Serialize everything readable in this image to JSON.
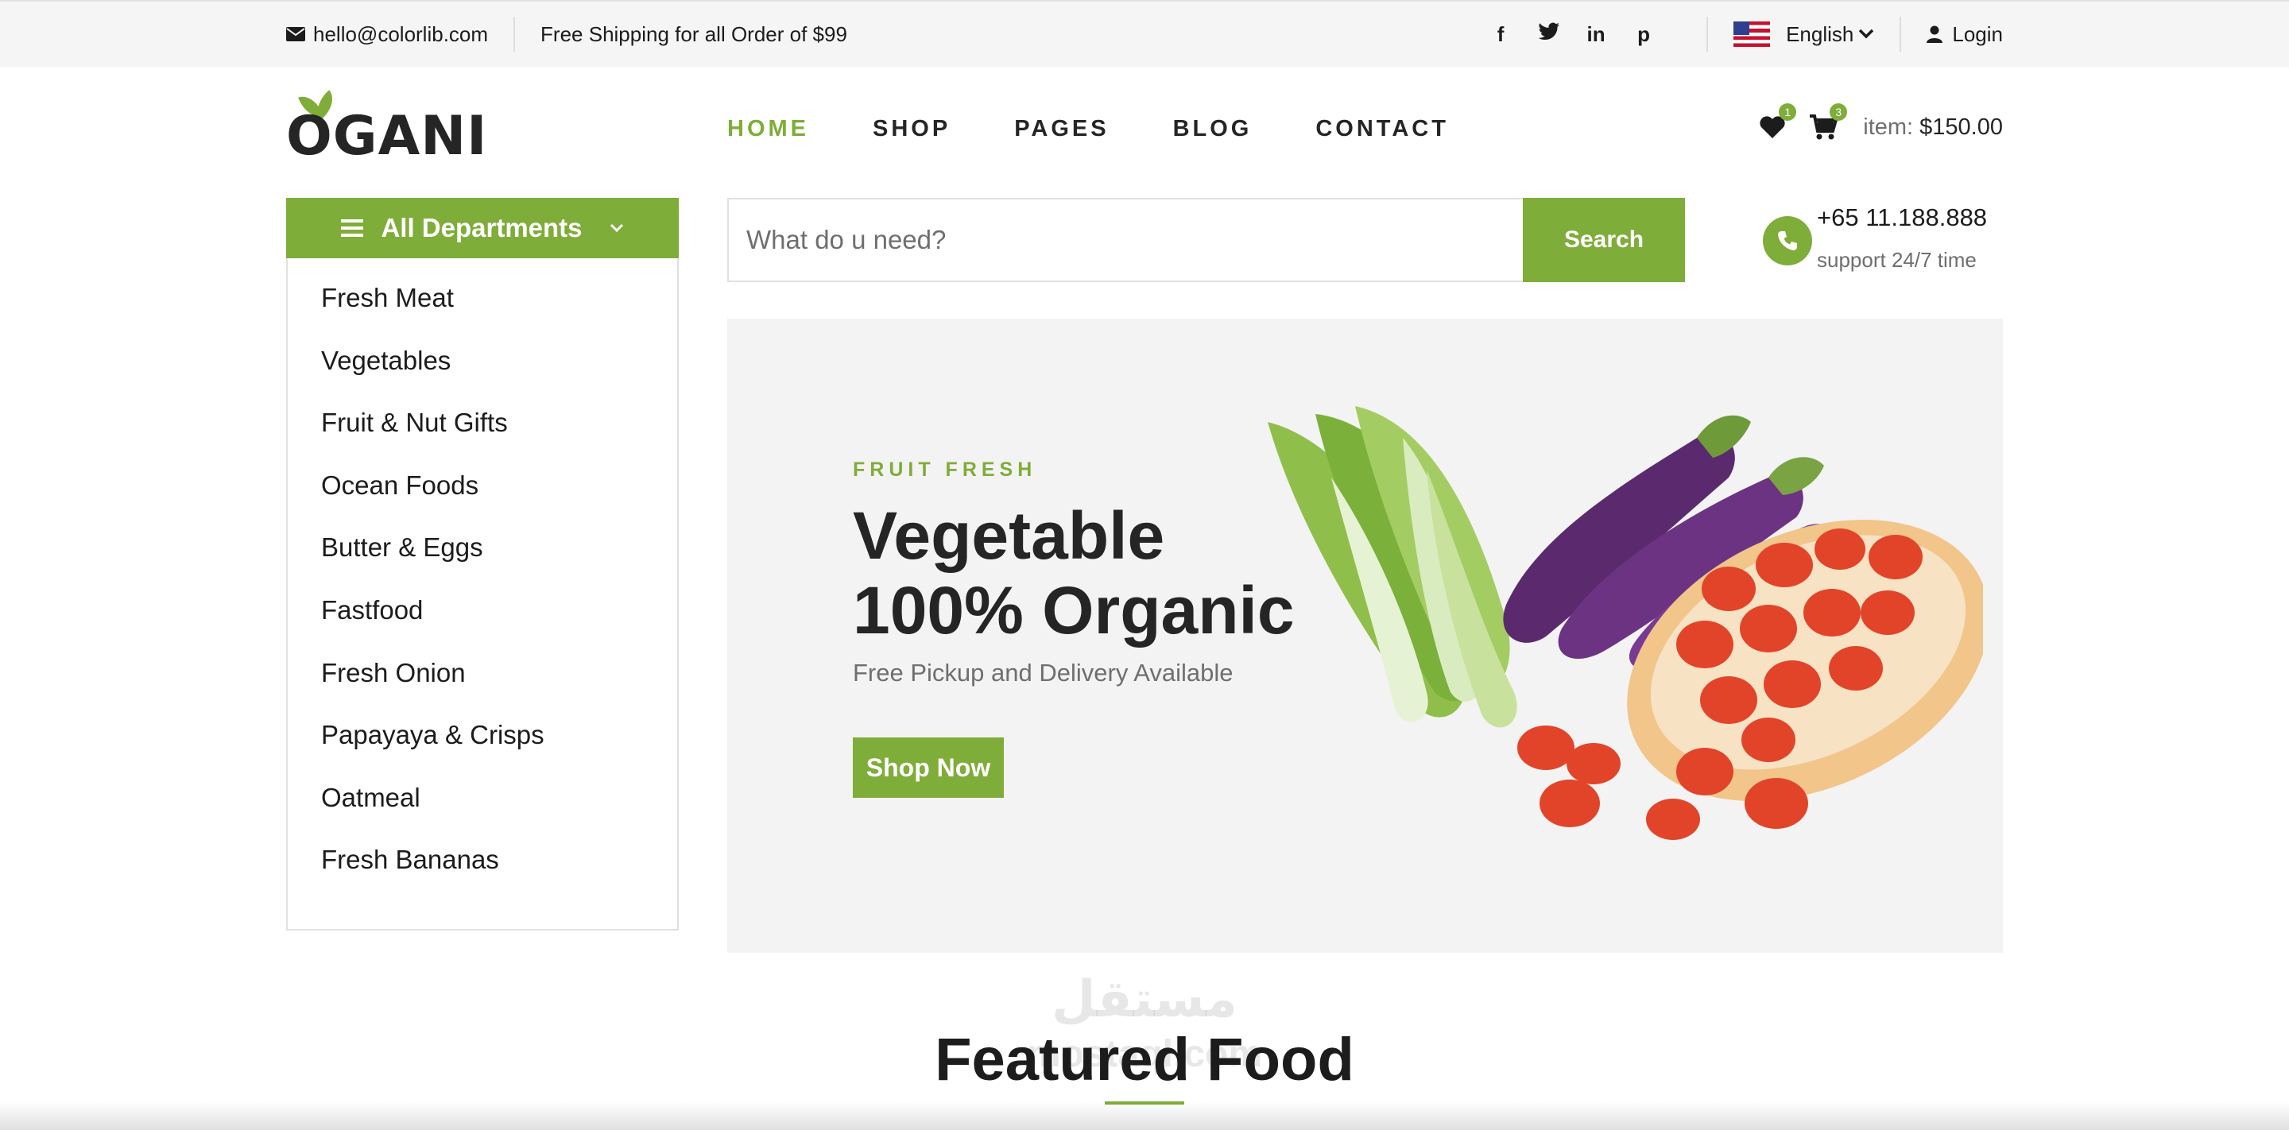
{
  "topbar": {
    "email": "hello@colorlib.com",
    "shipping": "Free Shipping for all Order of $99",
    "social_icons": [
      "facebook-icon",
      "twitter-icon",
      "linkedin-icon",
      "pinterest-icon"
    ],
    "social_glyphs": [
      "f",
      "t",
      "in",
      "p"
    ],
    "language": "English",
    "login": "Login"
  },
  "logo": {
    "text": "OGANI"
  },
  "nav": {
    "items": [
      "HOME",
      "SHOP",
      "PAGES",
      "BLOG",
      "CONTACT"
    ],
    "active": "HOME"
  },
  "cart": {
    "wishlist_count": "1",
    "cart_count": "3",
    "item_label": "item:",
    "total": "$150.00"
  },
  "departments": {
    "label": "All Departments",
    "items": [
      "Fresh Meat",
      "Vegetables",
      "Fruit & Nut Gifts",
      "Ocean Foods",
      "Butter & Eggs",
      "Fastfood",
      "Fresh Onion",
      "Papayaya & Crisps",
      "Oatmeal",
      "Fresh Bananas"
    ]
  },
  "search": {
    "placeholder": "What do u need?",
    "button": "Search"
  },
  "support": {
    "phone": "+65 11.188.888",
    "text": "support 24/7 time"
  },
  "hero": {
    "kicker": "FRUIT FRESH",
    "title": "Vegetable 100% Organic",
    "subtitle": "Free Pickup and Delivery Available",
    "button": "Shop Now"
  },
  "featured": {
    "title": "Featured Food"
  },
  "watermark": {
    "arabic": "مستقل",
    "latin": "mostaql.com"
  },
  "colors": {
    "accent": "#7fad39",
    "text": "#1c1c1c",
    "muted": "#6f6f6f",
    "hero_bg": "#f3f3f3"
  }
}
